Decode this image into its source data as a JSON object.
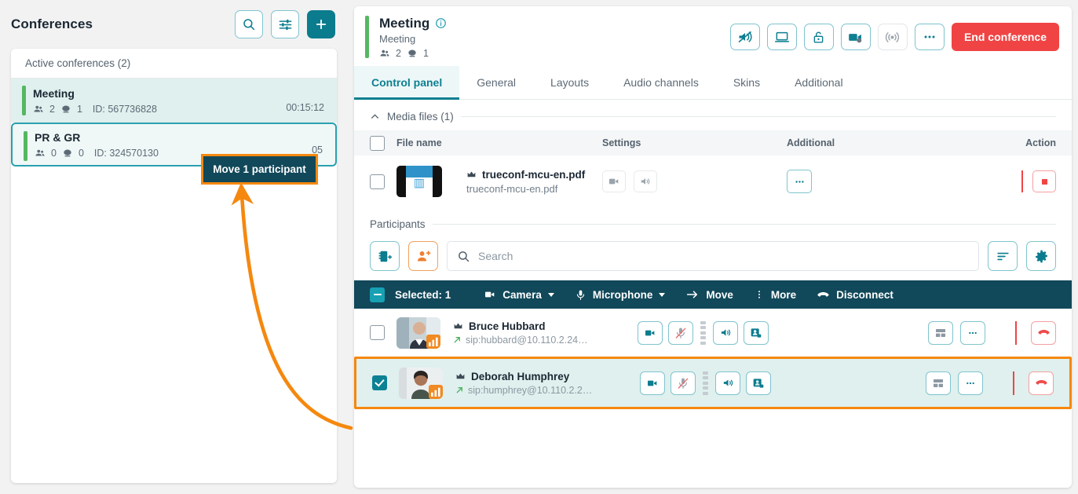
{
  "left": {
    "title": "Conferences",
    "buttons": [
      {
        "name": "search-icon",
        "label": "Search"
      },
      {
        "name": "filter-icon",
        "label": "Filters"
      },
      {
        "name": "plus-icon",
        "label": "Create conference"
      }
    ],
    "list_header": "Active conferences (2)",
    "conferences": [
      {
        "name": "Meeting",
        "participants": "2",
        "streams": "1",
        "id": "ID: 567736828",
        "timer": "00:15:12"
      },
      {
        "name": "PR & GR",
        "participants": "0",
        "streams": "0",
        "id": "ID: 324570130",
        "timer": "05"
      }
    ]
  },
  "header": {
    "title": "Meeting",
    "subtitle": "Meeting",
    "participants": "2",
    "streams": "1",
    "info_icon": "info-icon",
    "actions": [
      {
        "name": "mute-all-icon",
        "label": "Mute all"
      },
      {
        "name": "share-screen-icon",
        "label": "Share screen"
      },
      {
        "name": "lock-icon",
        "label": "Lock conference"
      },
      {
        "name": "recording-icon",
        "label": "Record"
      },
      {
        "name": "streaming-icon",
        "label": "Streaming"
      },
      {
        "name": "more-icon",
        "label": "More"
      }
    ],
    "end_label": "End conference"
  },
  "tabs": [
    {
      "label": "Control panel",
      "active": true
    },
    {
      "label": "General",
      "active": false
    },
    {
      "label": "Layouts",
      "active": false
    },
    {
      "label": "Audio channels",
      "active": false
    },
    {
      "label": "Skins",
      "active": false
    },
    {
      "label": "Additional",
      "active": false
    }
  ],
  "media": {
    "section_label": "Media files (1)",
    "columns": {
      "file": "File name",
      "settings": "Settings",
      "additional": "Additional",
      "action": "Action"
    },
    "rows": [
      {
        "name": "trueconf-mcu-en.pdf",
        "sub": "trueconf-mcu-en.pdf",
        "owner_icon": "crown-icon",
        "settings": [
          {
            "name": "video-file-icon",
            "label": "Video"
          },
          {
            "name": "audio-file-icon",
            "label": "Audio"
          }
        ],
        "additional": [
          {
            "name": "more-icon",
            "label": "More"
          }
        ],
        "action": [
          {
            "name": "stop-icon",
            "label": "Stop"
          }
        ],
        "checked": false
      }
    ]
  },
  "participants": {
    "section_label": "Participants",
    "toolbar": [
      {
        "name": "add-from-addressbook-icon",
        "label": "Invite from address book"
      },
      {
        "name": "add-participant-icon",
        "label": "Invite participant"
      }
    ],
    "search_placeholder": "Search",
    "search_value": "",
    "right_buttons": [
      {
        "name": "sort-icon",
        "label": "Sort"
      },
      {
        "name": "gear-icon",
        "label": "Settings"
      }
    ],
    "selection_bar": {
      "selected_label": "Selected: 1",
      "items": [
        {
          "name": "camera-icon",
          "label": "Camera",
          "caret": true
        },
        {
          "name": "microphone-icon",
          "label": "Microphone",
          "caret": true
        },
        {
          "name": "move-icon",
          "label": "Move",
          "caret": false
        },
        {
          "name": "more-vertical-icon",
          "label": "More",
          "caret": false
        },
        {
          "name": "disconnect-icon",
          "label": "Disconnect",
          "caret": false
        }
      ]
    },
    "rows": [
      {
        "name": "Bruce Hubbard",
        "address": "sip:hubbard@10.110.2.24…",
        "owner_icon": "crown-icon",
        "checked": false,
        "highlighted": false
      },
      {
        "name": "Deborah Humphrey",
        "address": "sip:humphrey@10.110.2.2…",
        "owner_icon": "crown-icon",
        "checked": true,
        "highlighted": true
      }
    ]
  },
  "annotation": {
    "tooltip": "Move 1 participant",
    "accent_color": "#f5880f"
  },
  "colors": {
    "teal": "#0b7c8e",
    "dark_teal": "#11485a",
    "green": "#56b760",
    "red": "#f04444",
    "orange": "#f5880f"
  }
}
